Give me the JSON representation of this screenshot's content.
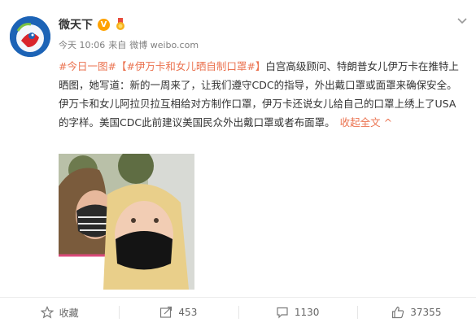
{
  "post": {
    "author": "微天下",
    "time": "今天 10:06",
    "source_prefix": "来自",
    "source": "微博 weibo.com",
    "topic1": "#今日一图#",
    "topic2": "【#伊万卡和女儿晒自制口罩#】",
    "body": "白宫高级顾问、特朗普女儿伊万卡在推特上晒图，她写道：新的一周来了，让我们遵守CDC的指导，外出戴口罩或面罩来确保安全。伊万卡和女儿阿拉贝拉互相给对方制作口罩，伊万卡还说女儿给自己的口罩上绣上了USA的字样。美国CDC此前建议美国民众外出戴口罩或者布面罩。",
    "collapse_label": "收起全文",
    "collapse_arrow": "^"
  },
  "actions": {
    "favorite_label": "收藏",
    "repost_count": "453",
    "comment_count": "1130",
    "like_count": "37355"
  },
  "icons": {
    "verified": "V"
  },
  "colors": {
    "topic": "#eb7350",
    "verified": "#ffa200",
    "avatar_bg": "#1c63b6"
  }
}
